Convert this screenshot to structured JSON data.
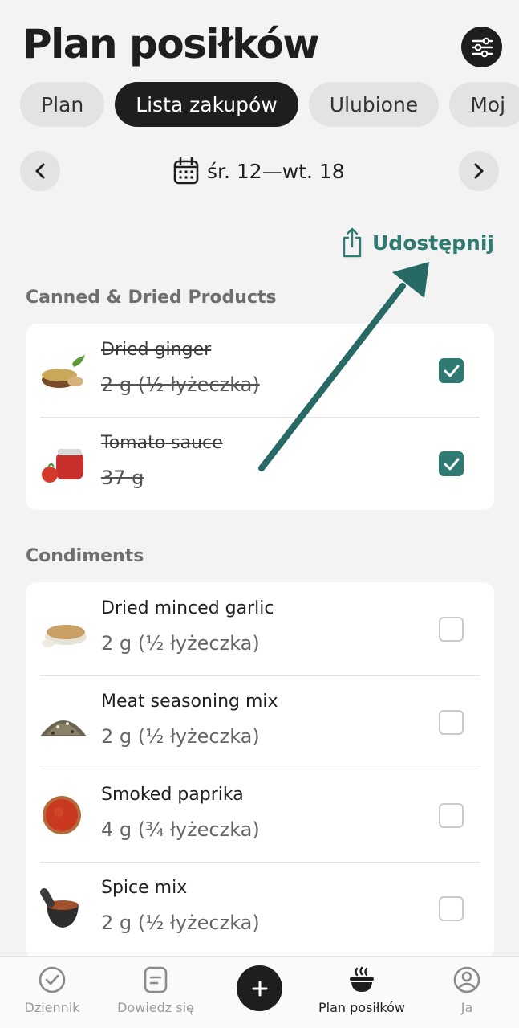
{
  "header": {
    "title": "Plan posiłków",
    "settings_icon": "sliders-icon"
  },
  "tabs": [
    {
      "label": "Plan",
      "active": false
    },
    {
      "label": "Lista zakupów",
      "active": true
    },
    {
      "label": "Ulubione",
      "active": false
    },
    {
      "label": "Moj",
      "active": false
    }
  ],
  "date_nav": {
    "range": "śr. 12—wt. 18",
    "prev_icon": "chevron-left-icon",
    "next_icon": "chevron-right-icon",
    "calendar_icon": "calendar-icon"
  },
  "share": {
    "label": "Udostępnij",
    "icon": "share-icon"
  },
  "sections": [
    {
      "title": "Canned & Dried Products",
      "items": [
        {
          "name": "Dried ginger",
          "qty": "2 g (½ łyżeczka)",
          "checked": true
        },
        {
          "name": "Tomato sauce",
          "qty": "37 g",
          "checked": true
        }
      ]
    },
    {
      "title": "Condiments",
      "items": [
        {
          "name": "Dried minced garlic",
          "qty": "2 g (½ łyżeczka)",
          "checked": false
        },
        {
          "name": "Meat seasoning mix",
          "qty": "2 g (½ łyżeczka)",
          "checked": false
        },
        {
          "name": "Smoked paprika",
          "qty": "4 g (¾ łyżeczka)",
          "checked": false
        },
        {
          "name": "Spice mix",
          "qty": "2 g (½ łyżeczka)",
          "checked": false
        }
      ]
    }
  ],
  "bottom_nav": [
    {
      "label": "Dziennik",
      "icon": "check-circle-icon",
      "active": false
    },
    {
      "label": "Dowiedz się",
      "icon": "note-icon",
      "active": false
    },
    {
      "label": "",
      "icon": "plus-icon",
      "active": false
    },
    {
      "label": "Plan posiłków",
      "icon": "bowl-icon",
      "active": true
    },
    {
      "label": "Ja",
      "icon": "profile-icon",
      "active": false
    }
  ],
  "colors": {
    "accent": "#2f7a72",
    "dark": "#1e1e1e",
    "background": "#f3f3f3"
  }
}
